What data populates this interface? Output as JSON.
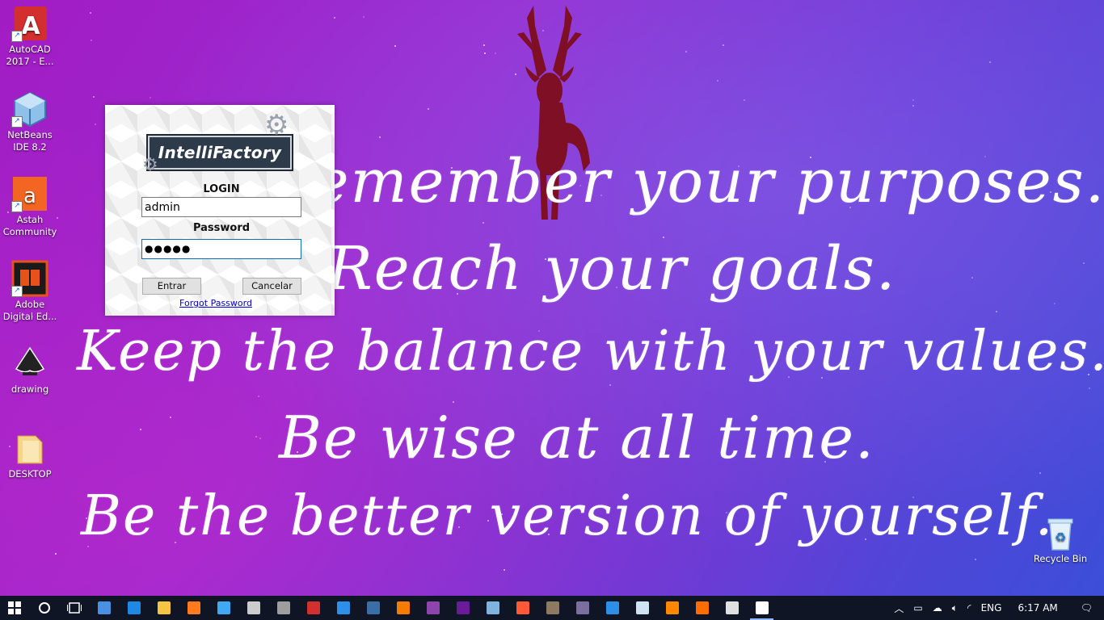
{
  "wallpaper": {
    "quote_lines": [
      "Remember your purposes.",
      "Reach your goals.",
      "Keep the balance with your values.",
      "Be wise at all time.",
      "Be the better version of yourself."
    ]
  },
  "desktop_icons": [
    {
      "label": "AutoCAD 2017 - E...",
      "icon": "autocad-icon",
      "color": "#d32f2f"
    },
    {
      "label": "NetBeans IDE 8.2",
      "icon": "netbeans-icon",
      "color": "#7fb3e0"
    },
    {
      "label": "Astah Community",
      "icon": "astah-icon",
      "color": "#f26522"
    },
    {
      "label": "Adobe Digital Ed...",
      "icon": "adobe-digital-editions-icon",
      "color": "#e8501c"
    },
    {
      "label": "drawing",
      "icon": "inkscape-icon",
      "color": "#222222"
    },
    {
      "label": "DESKTOP",
      "icon": "folder-icon",
      "color": "#f0c060"
    },
    {
      "label": "Recycle Bin",
      "icon": "recycle-bin-icon",
      "color": "#cfe6f7"
    }
  ],
  "login": {
    "logo": "IntelliFactory",
    "login_label": "LOGIN",
    "username_value": "admin",
    "password_label": "Password",
    "password_value": "●●●●●",
    "enter_button": "Entrar",
    "cancel_button": "Cancelar",
    "forgot_link": "Forgot Password"
  },
  "taskbar": {
    "apps": [
      {
        "icon": "store-icon",
        "color": "#4a90e2"
      },
      {
        "icon": "edge-icon",
        "color": "#1e88e5"
      },
      {
        "icon": "file-explorer-icon",
        "color": "#f5c542"
      },
      {
        "icon": "firefox-icon",
        "color": "#ff7a1a"
      },
      {
        "icon": "internet-explorer-icon",
        "color": "#3fa9f5"
      },
      {
        "icon": "inkscape-icon",
        "color": "#cccccc"
      },
      {
        "icon": "app-icon",
        "color": "#9e9e9e"
      },
      {
        "icon": "autocad-icon",
        "color": "#d32f2f"
      },
      {
        "icon": "vscode-icon",
        "color": "#2d8fe8"
      },
      {
        "icon": "app-icon",
        "color": "#3a6ea5"
      },
      {
        "icon": "app-icon",
        "color": "#f57c00"
      },
      {
        "icon": "visual-studio-icon",
        "color": "#8e44ad"
      },
      {
        "icon": "visual-studio-icon",
        "color": "#6a1b9a"
      },
      {
        "icon": "netbeans-icon",
        "color": "#7fb3e0"
      },
      {
        "icon": "app-icon",
        "color": "#ff5a36"
      },
      {
        "icon": "gimp-icon",
        "color": "#8d7a60"
      },
      {
        "icon": "app-icon",
        "color": "#7a6fa0"
      },
      {
        "icon": "app-icon",
        "color": "#2d8fe8"
      },
      {
        "icon": "notepad-icon",
        "color": "#cfe3f5"
      },
      {
        "icon": "vlc-icon",
        "color": "#ff8800"
      },
      {
        "icon": "media-player-icon",
        "color": "#ff6d00"
      },
      {
        "icon": "document-icon",
        "color": "#e0e0e0"
      },
      {
        "icon": "java-app-icon",
        "color": "#ffffff"
      }
    ],
    "language": "ENG",
    "time": "6:17 AM"
  }
}
